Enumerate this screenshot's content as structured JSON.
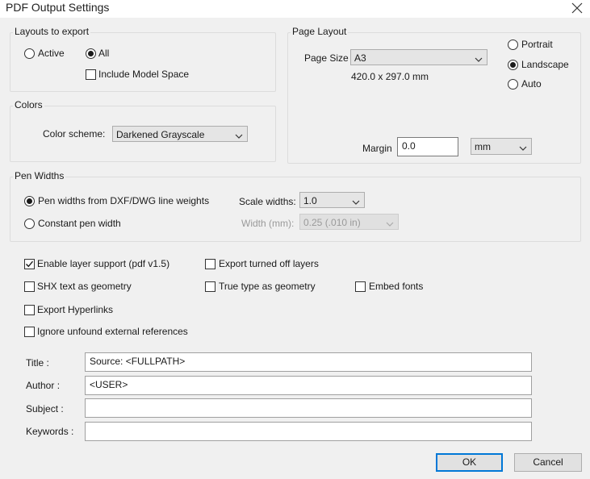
{
  "window": {
    "title": "PDF Output Settings"
  },
  "layouts": {
    "group_label": "Layouts to export",
    "active_label": "Active",
    "all_label": "All",
    "include_model_space_label": "Include Model Space",
    "selected": "All",
    "include_model_space": false
  },
  "colors": {
    "group_label": "Colors",
    "scheme_label": "Color scheme:",
    "scheme_value": "Darkened Grayscale"
  },
  "page_layout": {
    "group_label": "Page Layout",
    "page_size_label": "Page Size",
    "page_size_value": "A3",
    "dimensions": "420.0 x 297.0 mm",
    "portrait_label": "Portrait",
    "landscape_label": "Landscape",
    "auto_label": "Auto",
    "orientation": "Landscape",
    "margin_label": "Margin",
    "margin_value": "0.0",
    "margin_unit": "mm"
  },
  "pen_widths": {
    "group_label": "Pen Widths",
    "from_dxf_label": "Pen widths from DXF/DWG line weights",
    "constant_label": "Constant pen width",
    "selected": "Pen widths from DXF/DWG line weights",
    "scale_widths_label": "Scale widths:",
    "scale_widths_value": "1.0",
    "width_label": "Width (mm):",
    "width_value": "0.25  (.010 in)"
  },
  "options": {
    "enable_layer_support": {
      "label": "Enable layer support (pdf v1.5)",
      "checked": true
    },
    "export_turned_off_layers": {
      "label": "Export turned off layers",
      "checked": false
    },
    "shx_text_as_geometry": {
      "label": "SHX text as geometry",
      "checked": false
    },
    "true_type_as_geometry": {
      "label": "True type as geometry",
      "checked": false
    },
    "embed_fonts": {
      "label": "Embed fonts",
      "checked": false
    },
    "export_hyperlinks": {
      "label": "Export Hyperlinks",
      "checked": false
    },
    "ignore_unfound_refs": {
      "label": "Ignore unfound external references",
      "checked": false
    }
  },
  "metadata": {
    "title_label": "Title :",
    "title_value": "Source: <FULLPATH>",
    "author_label": "Author :",
    "author_value": "<USER>",
    "subject_label": "Subject :",
    "subject_value": "",
    "keywords_label": "Keywords :",
    "keywords_value": ""
  },
  "buttons": {
    "ok": "OK",
    "cancel": "Cancel"
  },
  "colors_theme": {
    "accent": "#0078d7",
    "background": "#f0f0f0"
  }
}
